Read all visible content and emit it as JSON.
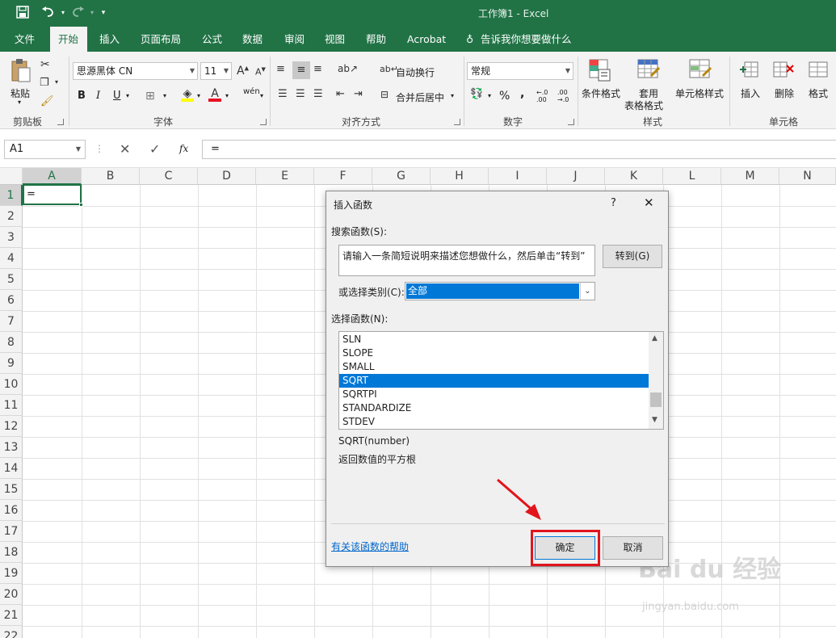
{
  "window": {
    "title": "工作簿1  -  Excel"
  },
  "quick_access": {
    "save_icon": "save-icon",
    "undo_icon": "undo-icon",
    "redo_icon": "redo-icon",
    "customize_icon": "customize-icon"
  },
  "tabs": [
    {
      "label": "文件"
    },
    {
      "label": "开始"
    },
    {
      "label": "插入"
    },
    {
      "label": "页面布局"
    },
    {
      "label": "公式"
    },
    {
      "label": "数据"
    },
    {
      "label": "审阅"
    },
    {
      "label": "视图"
    },
    {
      "label": "帮助"
    },
    {
      "label": "Acrobat"
    },
    {
      "label": "告诉我你想要做什么"
    }
  ],
  "ribbon": {
    "clipboard": {
      "paste": "粘贴",
      "group": "剪贴板"
    },
    "font": {
      "name": "思源黑体 CN",
      "size": "11",
      "bold": "B",
      "italic": "I",
      "underline": "U",
      "phonetic": "wén",
      "group": "字体"
    },
    "alignment": {
      "wrap": "自动换行",
      "merge": "合并后居中",
      "group": "对齐方式"
    },
    "number": {
      "format": "常规",
      "percent": "%",
      "comma": ",",
      "inc_dec": "←.0 .00",
      "dec_dec": ".00 →.0",
      "group": "数字"
    },
    "styles": {
      "conditional": "条件格式",
      "table_fmt_1": "套用",
      "table_fmt_2": "表格格式",
      "cell_styles": "单元格样式",
      "group": "样式"
    },
    "cells": {
      "insert": "插入",
      "delete": "删除",
      "format": "格式",
      "group": "单元格"
    }
  },
  "formula_bar": {
    "name_box": "A1",
    "fx": "fx",
    "content": "="
  },
  "sheet": {
    "columns": [
      "A",
      "B",
      "C",
      "D",
      "E",
      "F",
      "G",
      "H",
      "I",
      "J",
      "K",
      "L",
      "M",
      "N"
    ],
    "rows": [
      "1",
      "2",
      "3",
      "4",
      "5",
      "6",
      "7",
      "8",
      "9",
      "10",
      "11",
      "12",
      "13",
      "14",
      "15",
      "16",
      "17",
      "18",
      "19",
      "20",
      "21",
      "22"
    ],
    "cell_a1": "="
  },
  "dialog": {
    "title": "插入函数",
    "help_btn": "?",
    "search_label": "搜索函数(S):",
    "search_value": "请输入一条简短说明来描述您想做什么，然后单击“转到”",
    "go_button": "转到(G)",
    "category_label": "或选择类别(C):",
    "category_value": "全部",
    "function_label": "选择函数(N):",
    "functions": [
      "SLN",
      "SLOPE",
      "SMALL",
      "SQRT",
      "SQRTPI",
      "STANDARDIZE",
      "STDEV"
    ],
    "selected_function": "SQRT",
    "signature": "SQRT(number)",
    "description": "返回数值的平方根",
    "help_link": "有关该函数的帮助",
    "ok": "确定",
    "cancel": "取消"
  },
  "watermark": {
    "brand": "Bai du 经验",
    "url": "jingyan.baidu.com"
  },
  "colors": {
    "excel_green": "#217346",
    "select_blue": "#0078d7",
    "highlight_red": "#e2141c"
  }
}
